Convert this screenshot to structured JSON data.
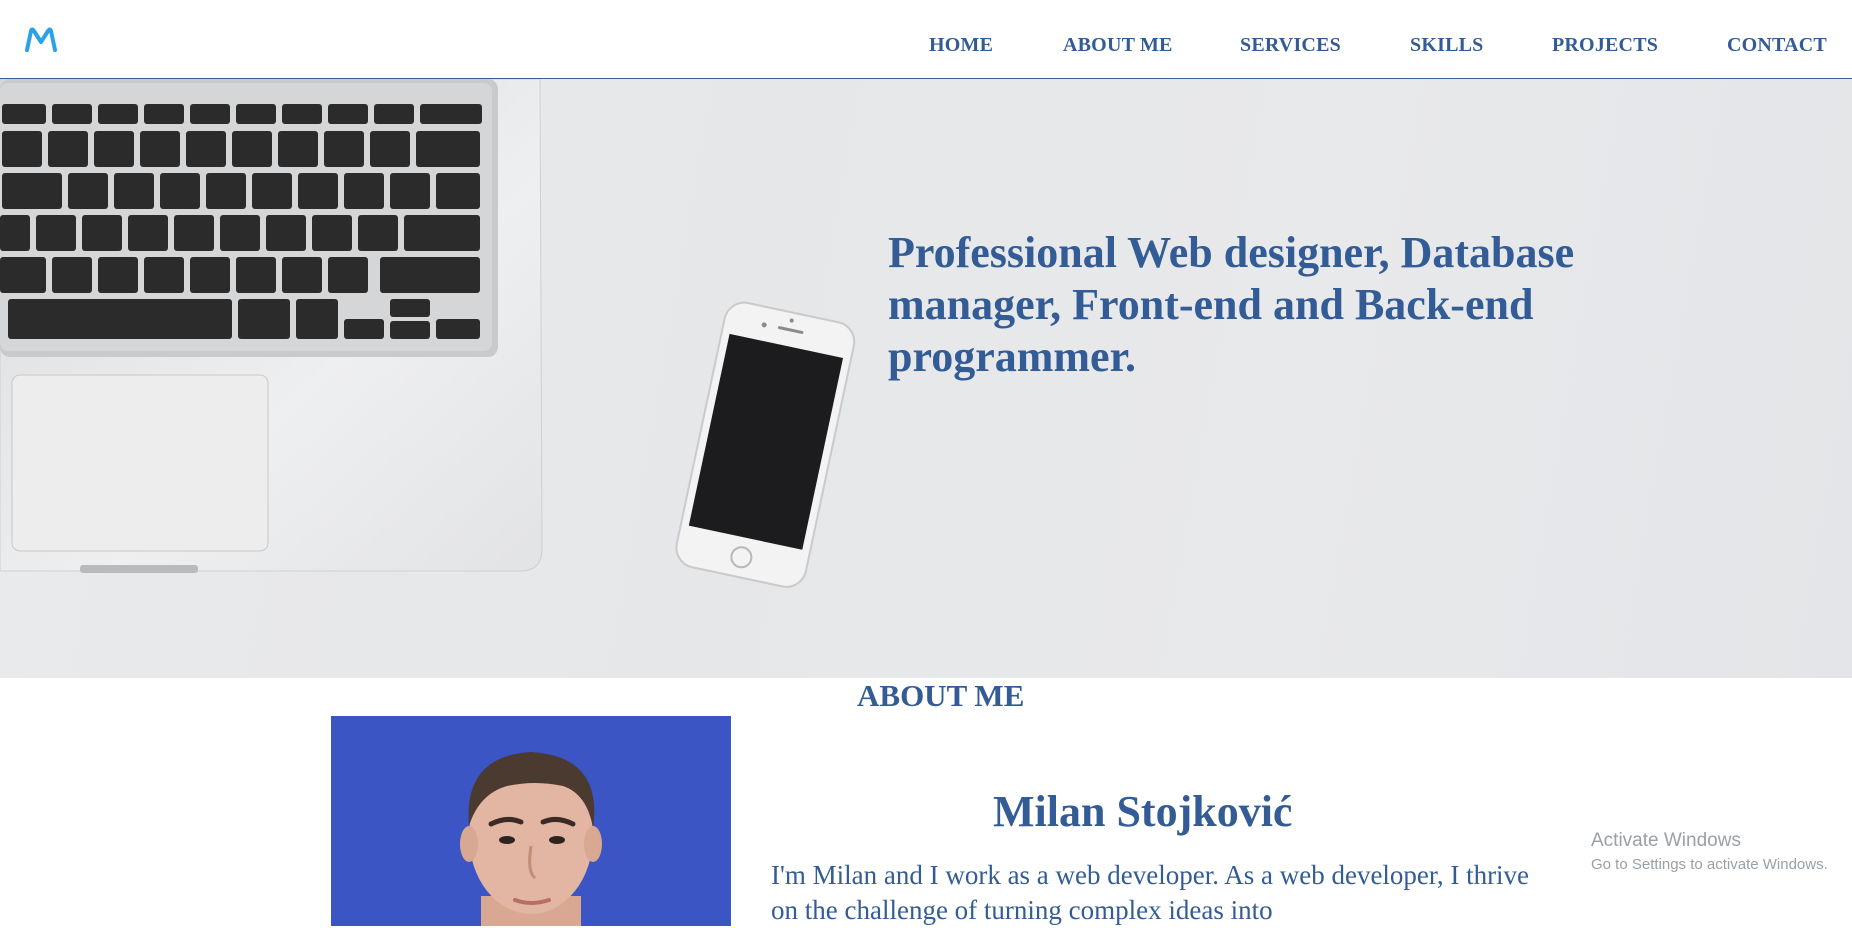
{
  "header": {
    "logo": "M",
    "nav": [
      {
        "label": "HOME"
      },
      {
        "label": "ABOUT ME"
      },
      {
        "label": "SERVICES"
      },
      {
        "label": "SKILLS"
      },
      {
        "label": "PROJECTS"
      },
      {
        "label": "CONTACT"
      }
    ]
  },
  "hero": {
    "title": "Professional Web designer, Database manager, Front-end and Back-end programmer."
  },
  "about": {
    "heading": "ABOUT ME",
    "name": "Milan Stojković",
    "bio": "I'm Milan and I work as a web developer. As a web developer, I thrive on the challenge of turning complex ideas into"
  },
  "watermark": {
    "line1": "Activate Windows",
    "line2": "Go to Settings to activate Windows."
  },
  "colors": {
    "brand": "#335c96",
    "logo": "#29a3e6",
    "photo_background": "#3b55c4"
  }
}
